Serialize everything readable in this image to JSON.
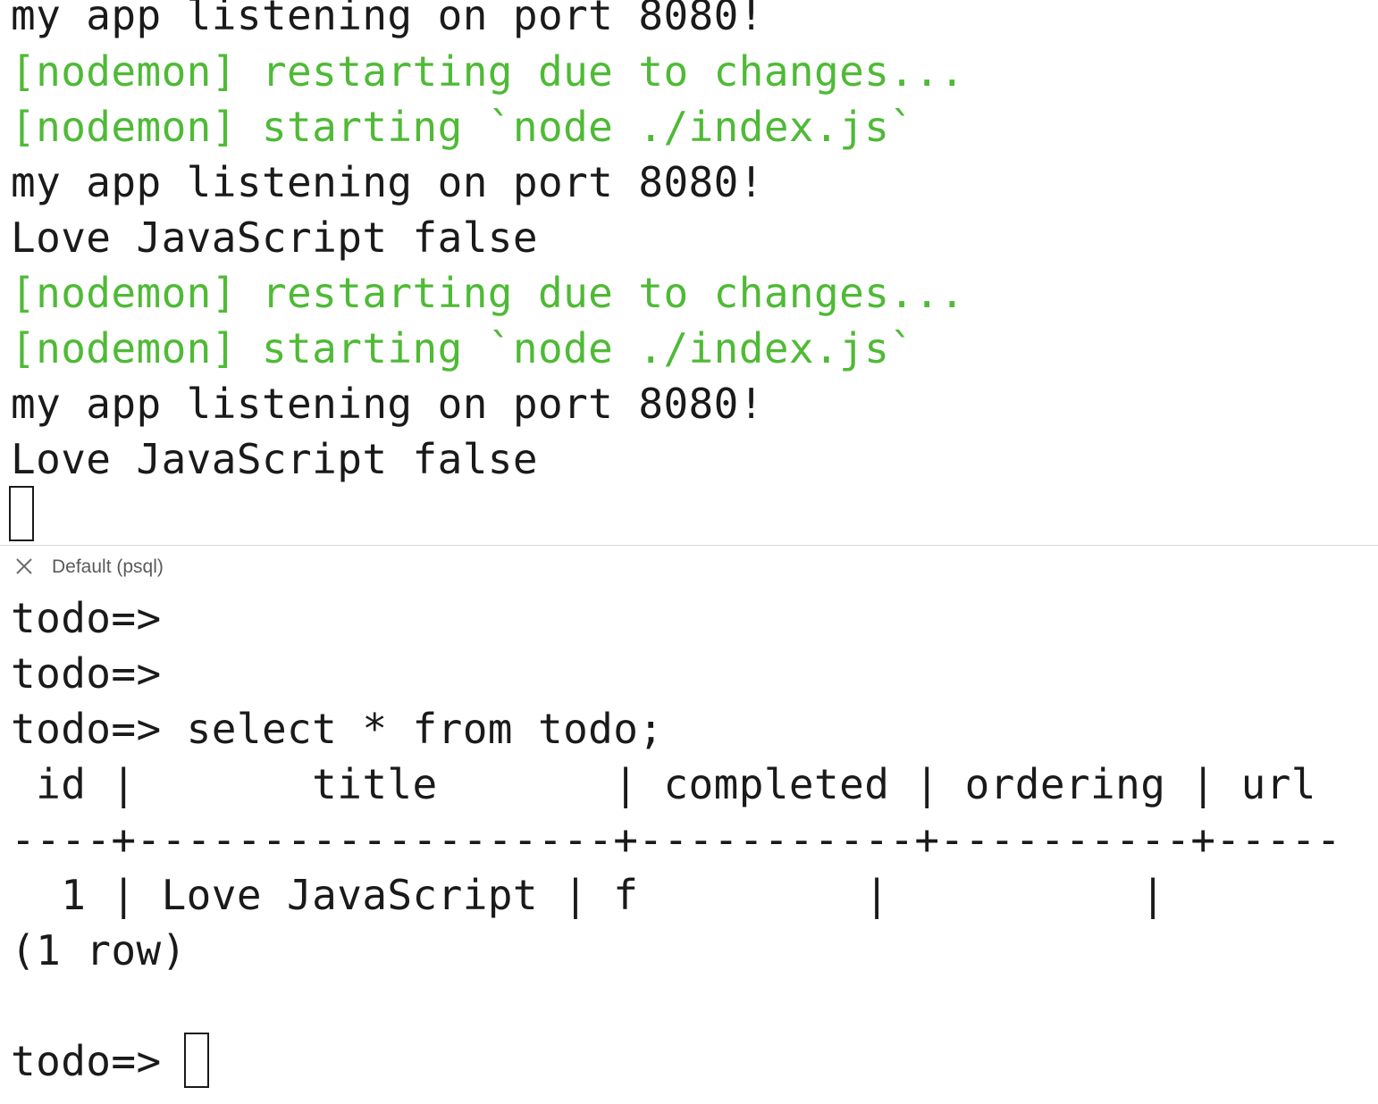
{
  "colors": {
    "nodemon_green": "#4fba36",
    "text": "#1a1a1a",
    "tab_label": "#5a5a5a",
    "divider": "#d6d6d6"
  },
  "top_terminal": {
    "lines": [
      "my app listening on port 8080!",
      "[nodemon] restarting due to changes...",
      "[nodemon] starting `node ./index.js`",
      "my app listening on port 8080!",
      "Love JavaScript false",
      "[nodemon] restarting due to changes...",
      "[nodemon] starting `node ./index.js`",
      "my app listening on port 8080!",
      "Love JavaScript false"
    ]
  },
  "bottom_terminal": {
    "tab": {
      "close_icon": "close-icon",
      "label": "Default (psql)"
    },
    "lines": [
      "todo=>",
      "todo=>",
      "todo=> select * from todo;",
      " id |       title       | completed | ordering | url",
      "----+-------------------+-----------+----------+-----",
      "  1 | Love JavaScript | f         |          |",
      "(1 row)",
      "",
      "todo=> "
    ]
  }
}
